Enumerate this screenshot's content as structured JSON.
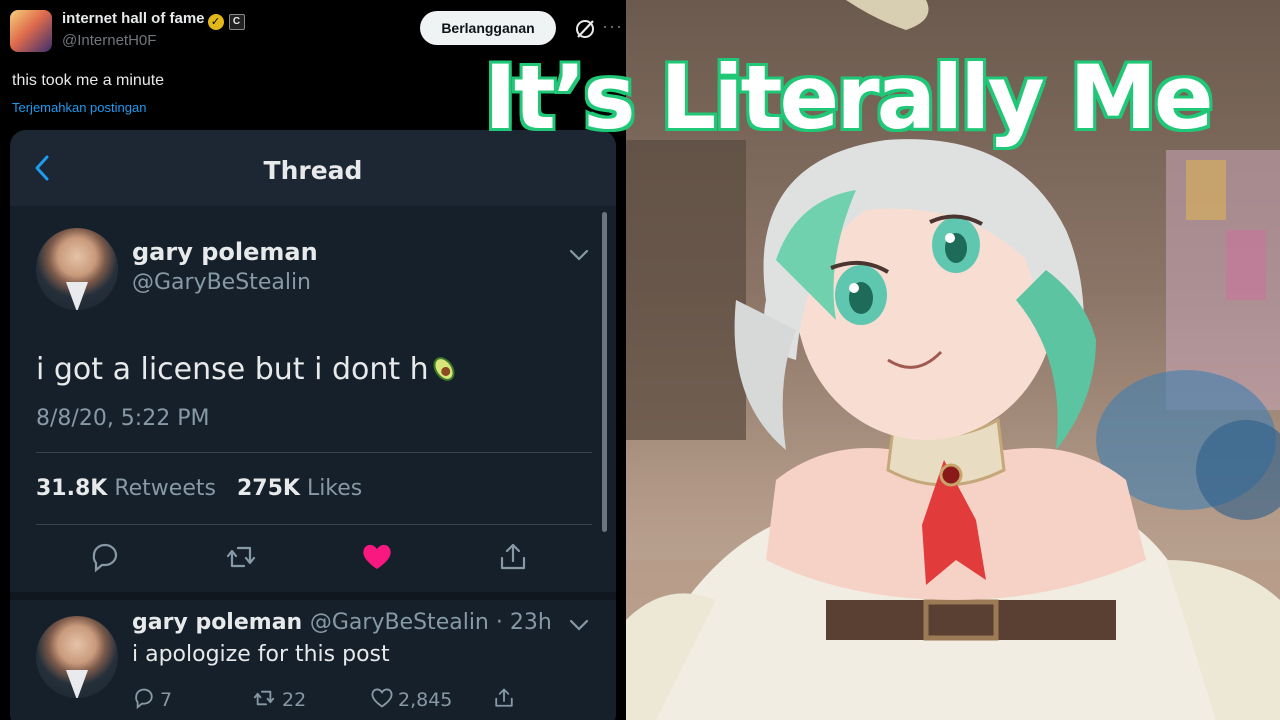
{
  "outer_post": {
    "author_name": "internet hall of fame",
    "verified_mark": "✓",
    "badge": "C",
    "handle": "@InternetH0F",
    "subscribe_label": "Berlangganan",
    "more_label": "···",
    "text": "this took me a minute",
    "translate_label": "Terjemahkan postingan"
  },
  "thread": {
    "title": "Thread",
    "main_tweet": {
      "name": "gary poleman",
      "handle": "@GaryBeStealin",
      "text": "i got a license but i dont h",
      "emoji": "avocado",
      "timestamp": "8/8/20, 5:22 PM",
      "retweets_count": "31.8K",
      "retweets_label": "Retweets",
      "likes_count": "275K",
      "likes_label": "Likes"
    },
    "reply": {
      "name": "gary poleman",
      "meta": "@GaryBeStealin · 23h",
      "text": "i apologize for this post",
      "replies": "7",
      "retweets": "22",
      "likes": "2,845"
    }
  },
  "overlay_title": "It’s Literally Me",
  "colors": {
    "accent_blue": "#1d9bf0",
    "like_red": "#f91880",
    "title_outline": "#1fc777",
    "embed_bg": "#15202b"
  }
}
